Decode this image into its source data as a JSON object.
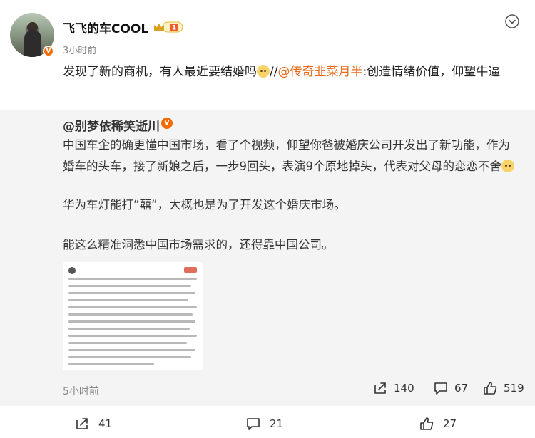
{
  "author": {
    "name": "飞飞的车COOL",
    "time": "3小时前",
    "verified_badge": "V",
    "level_badge": "1"
  },
  "post": {
    "text_before": "发现了新的商机，有人最近要结婚吗",
    "separator": "//",
    "mention": "@传奇韭菜月半",
    "text_after": ":创造情绪价值，仰望牛逼"
  },
  "repost": {
    "author": "@别梦依稀笑逝川",
    "verified_badge": "V",
    "paragraph1": "中国车企的确更懂中国市场，看了个视频，仰望你爸被婚庆公司开发出了新功能，作为婚车的头车，接了新娘之后，一步9回头，表演9个原地掉头，代表对父母的恋恋不舍",
    "paragraph2": "华为车灯能打“囍”，大概也是为了开发这个婚庆市场。",
    "paragraph3": "能这么精准洞悉中国市场需求的，还得靠中国公司。",
    "time": "5小时前",
    "shares": "140",
    "comments": "67",
    "likes": "519"
  },
  "footer": {
    "shares": "41",
    "comments": "21",
    "likes": "27"
  },
  "icons": {
    "more": "chevron-down-icon",
    "share": "share-icon",
    "comment": "comment-icon",
    "like": "thumbs-up-icon"
  },
  "colors": {
    "mention": "#e86b1c",
    "verified": "#f26a00",
    "repost_bg": "#f4f4f4"
  }
}
